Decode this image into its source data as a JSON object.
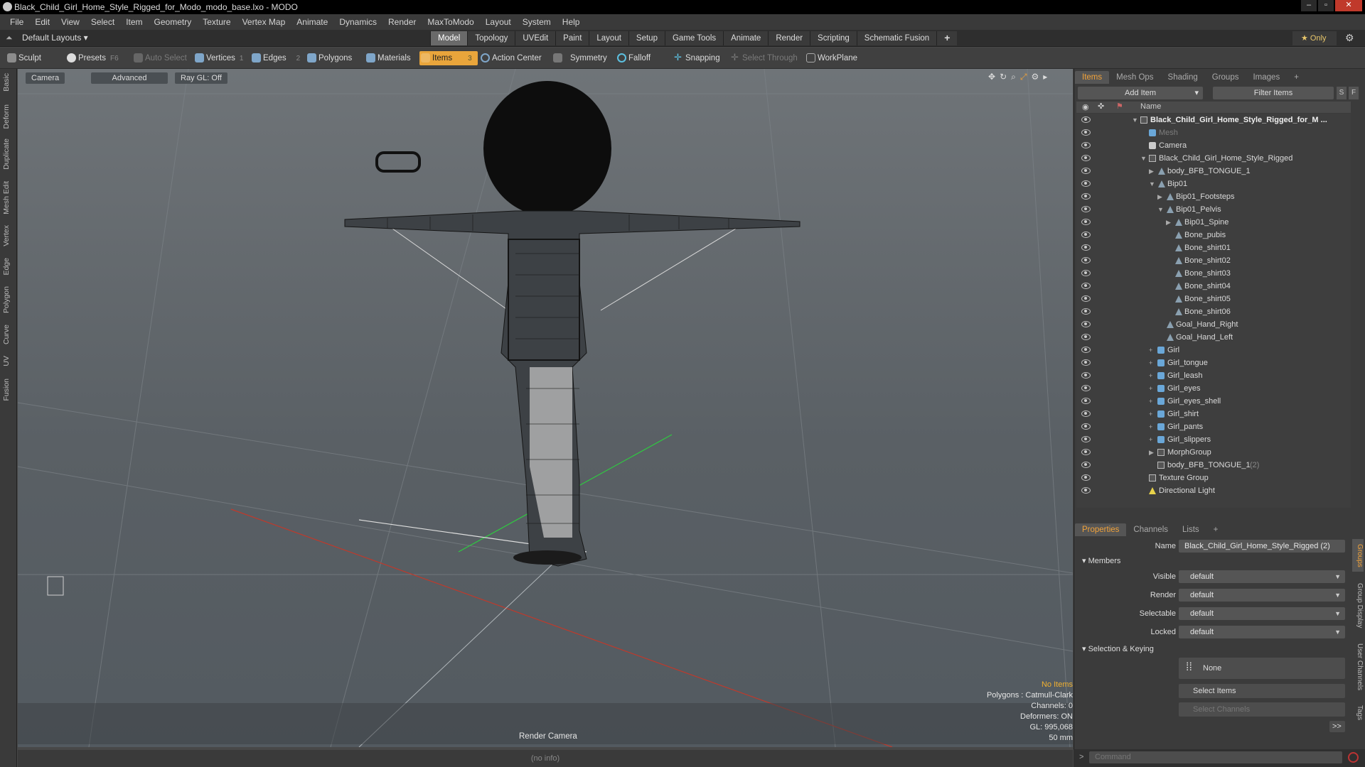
{
  "title": "Black_Child_Girl_Home_Style_Rigged_for_Modo_modo_base.lxo - MODO",
  "menu": [
    "File",
    "Edit",
    "View",
    "Select",
    "Item",
    "Geometry",
    "Texture",
    "Vertex Map",
    "Animate",
    "Dynamics",
    "Render",
    "MaxToModo",
    "Layout",
    "System",
    "Help"
  ],
  "layout_select": "Default Layouts",
  "layout_tabs": [
    "Model",
    "Topology",
    "UVEdit",
    "Paint",
    "Layout",
    "Setup",
    "Game Tools",
    "Animate",
    "Render",
    "Scripting",
    "Schematic Fusion"
  ],
  "only_label": "Only",
  "toolbar": {
    "sculpt": "Sculpt",
    "presets": "Presets",
    "presets_key": "F6",
    "auto_select": "Auto Select",
    "vertices": "Vertices",
    "vertices_n": "1",
    "edges": "Edges",
    "edges_n": "2",
    "polygons": "Polygons",
    "materials": "Materials",
    "items": "Items",
    "items_n": "3",
    "action_center": "Action Center",
    "symmetry": "Symmetry",
    "falloff": "Falloff",
    "snapping": "Snapping",
    "select_through": "Select Through",
    "workplane": "WorkPlane"
  },
  "left_tabs": [
    "Basic",
    "Deform",
    "Duplicate",
    "Mesh Edit",
    "Vertex",
    "Edge",
    "Polygon",
    "Curve",
    "UV",
    "Fusion"
  ],
  "viewport": {
    "camera": "Camera",
    "advanced": "Advanced",
    "raygl": "Ray GL: Off",
    "info": [
      "No Items",
      "Polygons : Catmull-Clark",
      "Channels: 0",
      "Deformers: ON",
      "GL: 995,068",
      "50 mm"
    ],
    "camera_name": "Render Camera",
    "status": "(no info)"
  },
  "items_panel": {
    "tabs": [
      "Items",
      "Mesh Ops",
      "Shading",
      "Groups",
      "Images"
    ],
    "add_item": "Add Item",
    "filter_items": "Filter Items",
    "column_name": "Name",
    "rows": [
      {
        "label": "Black_Child_Girl_Home_Style_Rigged_for_M ...",
        "indent": 0,
        "arrow": "▼",
        "icon": "grp",
        "style": "bold"
      },
      {
        "label": "Mesh",
        "indent": 1,
        "arrow": "",
        "icon": "mesh",
        "style": "dim"
      },
      {
        "label": "Camera",
        "indent": 1,
        "arrow": "",
        "icon": "cam",
        "style": ""
      },
      {
        "label": "Black_Child_Girl_Home_Style_Rigged",
        "indent": 1,
        "arrow": "▼",
        "icon": "grp",
        "style": ""
      },
      {
        "label": "body_BFB_TONGUE_1",
        "indent": 2,
        "arrow": "▶",
        "icon": "bone",
        "style": ""
      },
      {
        "label": "Bip01",
        "indent": 2,
        "arrow": "▼",
        "icon": "bone",
        "style": ""
      },
      {
        "label": "Bip01_Footsteps",
        "indent": 3,
        "arrow": "▶",
        "icon": "bone",
        "style": ""
      },
      {
        "label": "Bip01_Pelvis",
        "indent": 3,
        "arrow": "▼",
        "icon": "bone",
        "style": ""
      },
      {
        "label": "Bip01_Spine",
        "indent": 4,
        "arrow": "▶",
        "icon": "bone",
        "style": ""
      },
      {
        "label": "Bone_pubis",
        "indent": 4,
        "arrow": "",
        "icon": "bone",
        "style": ""
      },
      {
        "label": "Bone_shirt01",
        "indent": 4,
        "arrow": "",
        "icon": "bone",
        "style": ""
      },
      {
        "label": "Bone_shirt02",
        "indent": 4,
        "arrow": "",
        "icon": "bone",
        "style": ""
      },
      {
        "label": "Bone_shirt03",
        "indent": 4,
        "arrow": "",
        "icon": "bone",
        "style": ""
      },
      {
        "label": "Bone_shirt04",
        "indent": 4,
        "arrow": "",
        "icon": "bone",
        "style": ""
      },
      {
        "label": "Bone_shirt05",
        "indent": 4,
        "arrow": "",
        "icon": "bone",
        "style": ""
      },
      {
        "label": "Bone_shirt06",
        "indent": 4,
        "arrow": "",
        "icon": "bone",
        "style": ""
      },
      {
        "label": "Goal_Hand_Right",
        "indent": 3,
        "arrow": "",
        "icon": "bone",
        "style": ""
      },
      {
        "label": "Goal_Hand_Left",
        "indent": 3,
        "arrow": "",
        "icon": "bone",
        "style": ""
      },
      {
        "label": "Girl",
        "indent": 2,
        "arrow": "+",
        "icon": "mesh",
        "style": ""
      },
      {
        "label": "Girl_tongue",
        "indent": 2,
        "arrow": "+",
        "icon": "mesh",
        "style": ""
      },
      {
        "label": "Girl_leash",
        "indent": 2,
        "arrow": "+",
        "icon": "mesh",
        "style": ""
      },
      {
        "label": "Girl_eyes",
        "indent": 2,
        "arrow": "+",
        "icon": "mesh",
        "style": ""
      },
      {
        "label": "Girl_eyes_shell",
        "indent": 2,
        "arrow": "+",
        "icon": "mesh",
        "style": ""
      },
      {
        "label": "Girl_shirt",
        "indent": 2,
        "arrow": "+",
        "icon": "mesh",
        "style": ""
      },
      {
        "label": "Girl_pants",
        "indent": 2,
        "arrow": "+",
        "icon": "mesh",
        "style": ""
      },
      {
        "label": "Girl_slippers",
        "indent": 2,
        "arrow": "+",
        "icon": "mesh",
        "style": ""
      },
      {
        "label": "MorphGroup",
        "indent": 2,
        "arrow": "▶",
        "icon": "grp",
        "style": ""
      },
      {
        "label": "body_BFB_TONGUE_1",
        "indent": 2,
        "arrow": "",
        "icon": "grp",
        "style": "",
        "count": "(2)"
      },
      {
        "label": "Texture Group",
        "indent": 1,
        "arrow": "",
        "icon": "grp",
        "style": ""
      },
      {
        "label": "Directional Light",
        "indent": 1,
        "arrow": "",
        "icon": "light",
        "style": ""
      }
    ]
  },
  "properties": {
    "tabs": [
      "Properties",
      "Channels",
      "Lists"
    ],
    "name_label": "Name",
    "name_value": "Black_Child_Girl_Home_Style_Rigged (2)",
    "members": "Members",
    "fields": [
      {
        "label": "Visible",
        "value": "default"
      },
      {
        "label": "Render",
        "value": "default"
      },
      {
        "label": "Selectable",
        "value": "default"
      },
      {
        "label": "Locked",
        "value": "default"
      }
    ],
    "selection_keying": "Selection & Keying",
    "none_btn": "None",
    "select_items": "Select Items",
    "select_channels": "Select Channels",
    "more": ">>",
    "side_tabs": [
      "Groups",
      "Group Display",
      "User Channels",
      "Tags"
    ]
  },
  "command_placeholder": "Command",
  "colors": {
    "accent": "#f2a33a",
    "items_active": "#e9a53b",
    "viewport_top": "#6f7478"
  }
}
